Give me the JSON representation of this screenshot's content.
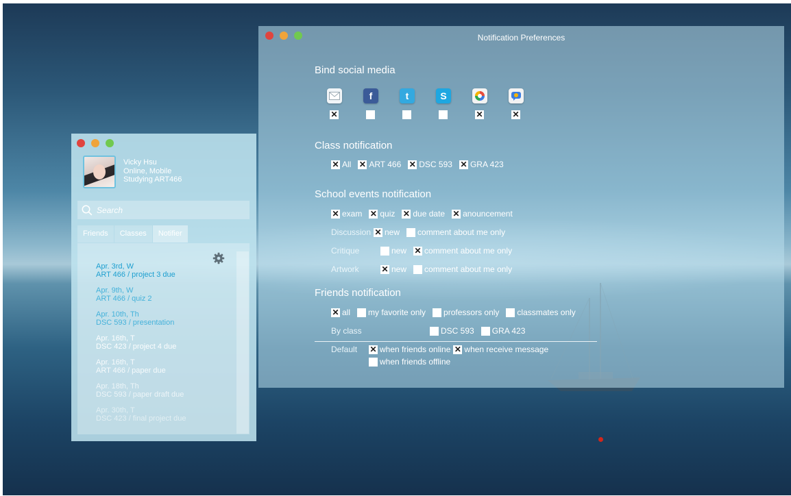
{
  "prefs_window": {
    "title": "Notification Preferences",
    "social": {
      "heading": "Bind social media",
      "items": [
        {
          "icon": "mail-icon",
          "checked": true
        },
        {
          "icon": "facebook-icon",
          "checked": false
        },
        {
          "icon": "twitter-icon",
          "checked": false
        },
        {
          "icon": "skype-icon",
          "checked": false
        },
        {
          "icon": "picasa-icon",
          "checked": true
        },
        {
          "icon": "google-talk-icon",
          "checked": true
        }
      ]
    },
    "class_notification": {
      "heading": "Class notification",
      "options": [
        {
          "label": "All",
          "checked": true
        },
        {
          "label": "ART 466",
          "checked": true
        },
        {
          "label": "DSC 593",
          "checked": true
        },
        {
          "label": "GRA 423",
          "checked": true
        }
      ]
    },
    "school_events": {
      "heading": "School events notification",
      "events": [
        {
          "label": "exam",
          "checked": true
        },
        {
          "label": "quiz",
          "checked": true
        },
        {
          "label": "due date",
          "checked": true
        },
        {
          "label": "anouncement",
          "checked": true
        }
      ],
      "discussion": {
        "label": "Discussion",
        "new": "new",
        "new_checked": true,
        "comment": "comment about me only",
        "comment_checked": false
      },
      "critique": {
        "label": "Critique",
        "new": "new",
        "new_checked": false,
        "comment": "comment about me only",
        "comment_checked": true
      },
      "artwork": {
        "label": "Artwork",
        "new": "new",
        "new_checked": true,
        "comment": "comment about me only",
        "comment_checked": false
      }
    },
    "friends": {
      "heading": "Friends notification",
      "options": [
        {
          "label": "all",
          "checked": true
        },
        {
          "label": "my favorite only",
          "checked": false
        },
        {
          "label": "professors only",
          "checked": false
        },
        {
          "label": "classmates only",
          "checked": false
        }
      ],
      "by_class": {
        "label": "By class",
        "options": [
          {
            "label": "DSC 593",
            "checked": false
          },
          {
            "label": "GRA 423",
            "checked": false
          }
        ]
      },
      "default": {
        "label": "Default",
        "online": {
          "label": "when friends online",
          "checked": true
        },
        "message": {
          "label": "when receive message",
          "checked": true
        },
        "offline": {
          "label": "when friends offline",
          "checked": false
        }
      }
    }
  },
  "contacts_window": {
    "user": {
      "name": "Vicky Hsu",
      "status": "Online, Mobile",
      "activity": "Studying ART466"
    },
    "search_placeholder": "Search",
    "tabs": [
      "Friends",
      "Classes",
      "Notifier"
    ],
    "active_tab": "Notifier",
    "notifications": [
      {
        "date": "Apr. 3rd, W",
        "text": "ART 466 / project 3 due",
        "color": "#1d9fd0"
      },
      {
        "date": "Apr. 9th, W",
        "text": "ART 466 / quiz 2",
        "color": "#45b2da"
      },
      {
        "date": "Apr. 10th, Th",
        "text": "DSC 593 / presentation",
        "color": "#45b2da"
      },
      {
        "date": "Apr. 16th, T",
        "text": "DSC 423 / project 4 due",
        "color": "#ffffff"
      },
      {
        "date": "Apr. 16th, T",
        "text": "ART 466 / paper due",
        "color": "#ffffff"
      },
      {
        "date": "Apr. 18th, Th",
        "text": "DSC 593 / paper draft due",
        "color": "#ffffff"
      },
      {
        "date": "Apr. 30th, T",
        "text": "DSC 423 / final project due",
        "color": "#ffffff"
      }
    ]
  },
  "colors": {
    "accent": "#1d9fd0",
    "window_tint": "#bae0ec",
    "sea_dark": "#15314d"
  }
}
